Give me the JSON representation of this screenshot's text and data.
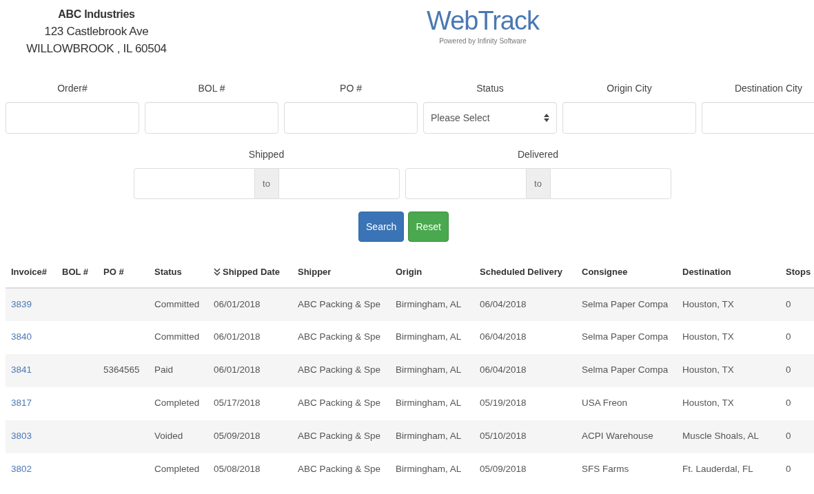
{
  "company": {
    "name": "ABC Industries",
    "address_line1": "123 Castlebrook Ave",
    "address_line2": "WILLOWBROOK , IL 60504"
  },
  "brand": {
    "title": "WebTrack",
    "tagline_prefix": "Powered by",
    "tagline_link": "Infinity Software"
  },
  "filters": [
    {
      "label": "Order#",
      "kind": "text"
    },
    {
      "label": "BOL #",
      "kind": "text"
    },
    {
      "label": "PO #",
      "kind": "text"
    },
    {
      "label": "Status",
      "kind": "select",
      "value": "Please Select"
    },
    {
      "label": "Origin City",
      "kind": "text"
    },
    {
      "label": "Destination City",
      "kind": "text"
    }
  ],
  "date_ranges": [
    {
      "label": "Shipped",
      "separator": "to"
    },
    {
      "label": "Delivered",
      "separator": "to"
    }
  ],
  "buttons": [
    {
      "label": "Search",
      "kind": "primary"
    },
    {
      "label": "Reset",
      "kind": "success"
    }
  ],
  "table": {
    "columns": [
      {
        "label": "Invoice#",
        "sorted": false
      },
      {
        "label": "BOL #",
        "sorted": false
      },
      {
        "label": "PO #",
        "sorted": false
      },
      {
        "label": "Status",
        "sorted": false
      },
      {
        "label": "Shipped Date",
        "sorted": true
      },
      {
        "label": "Shipper",
        "sorted": false
      },
      {
        "label": "Origin",
        "sorted": false
      },
      {
        "label": "Scheduled Delivery",
        "sorted": false
      },
      {
        "label": "Consignee",
        "sorted": false
      },
      {
        "label": "Destination",
        "sorted": false
      },
      {
        "label": "Stops",
        "sorted": false
      }
    ],
    "rows": [
      [
        "3839",
        "",
        "",
        "Committed",
        "06/01/2018",
        "ABC Packing & Spe",
        "Birmingham, AL",
        "06/04/2018",
        "Selma Paper Compa",
        "Houston, TX",
        "0"
      ],
      [
        "3840",
        "",
        "",
        "Committed",
        "06/01/2018",
        "ABC Packing & Spe",
        "Birmingham, AL",
        "06/04/2018",
        "Selma Paper Compa",
        "Houston, TX",
        "0"
      ],
      [
        "3841",
        "",
        "5364565",
        "Paid",
        "06/01/2018",
        "ABC Packing & Spe",
        "Birmingham, AL",
        "06/04/2018",
        "Selma Paper Compa",
        "Houston, TX",
        "0"
      ],
      [
        "3817",
        "",
        "",
        "Completed",
        "05/17/2018",
        "ABC Packing & Spe",
        "Birmingham, AL",
        "05/19/2018",
        "USA Freon",
        "Houston, TX",
        "0"
      ],
      [
        "3803",
        "",
        "",
        "Voided",
        "05/09/2018",
        "ABC Packing & Spe",
        "Birmingham, AL",
        "05/10/2018",
        "ACPI Warehouse",
        "Muscle Shoals, AL",
        "0"
      ],
      [
        "3802",
        "",
        "",
        "Completed",
        "05/08/2018",
        "ABC Packing & Spe",
        "Birmingham, AL",
        "05/09/2018",
        "SFS Farms",
        "Ft. Lauderdal, FL",
        "0"
      ]
    ]
  }
}
